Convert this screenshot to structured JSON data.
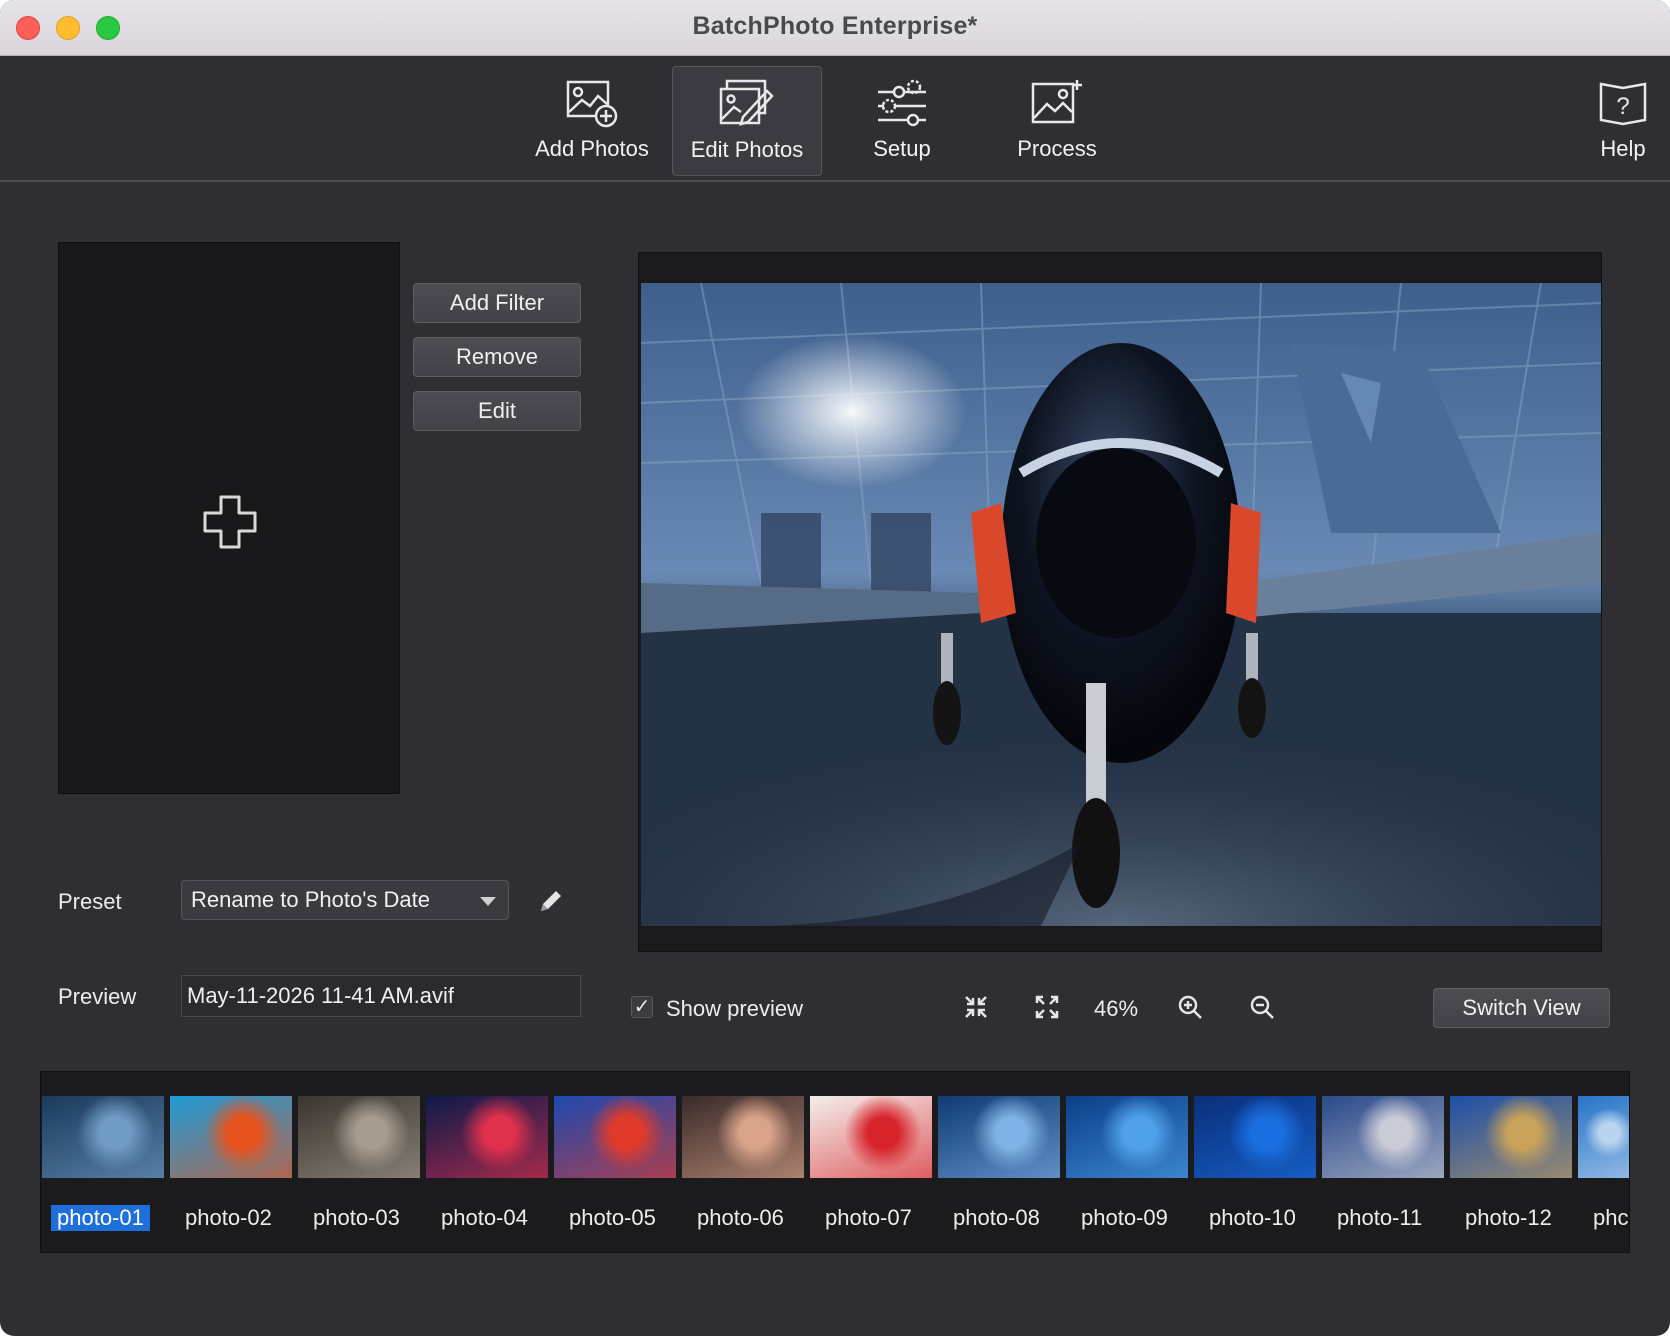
{
  "window": {
    "title": "BatchPhoto Enterprise*"
  },
  "toolbar": {
    "items": [
      {
        "label": "Add Photos",
        "icon": "add-photos-icon"
      },
      {
        "label": "Edit Photos",
        "icon": "edit-photos-icon",
        "active": true
      },
      {
        "label": "Setup",
        "icon": "setup-gears-icon"
      },
      {
        "label": "Process",
        "icon": "process-icon"
      }
    ],
    "help": {
      "label": "Help",
      "icon": "help-book-icon"
    }
  },
  "filters": {
    "add_label": "Add Filter",
    "remove_label": "Remove",
    "edit_label": "Edit"
  },
  "preset": {
    "label": "Preset",
    "value": "Rename to Photo's Date"
  },
  "preview_name": {
    "label": "Preview",
    "value": "May-11-2026 11-41 AM.avif"
  },
  "preview_controls": {
    "show_preview_label": "Show preview",
    "show_preview_checked": true,
    "zoom": "46%",
    "switch_view_label": "Switch View"
  },
  "filmstrip": {
    "items": [
      {
        "label": "photo-01",
        "selected": true,
        "colors": [
          "#1b3a5c",
          "#6f9bc4"
        ]
      },
      {
        "label": "photo-02",
        "colors": [
          "#1f9bd6",
          "#e8521c"
        ]
      },
      {
        "label": "photo-03",
        "colors": [
          "#3a3530",
          "#a69c8f"
        ]
      },
      {
        "label": "photo-04",
        "colors": [
          "#0c1a4a",
          "#e1304c"
        ]
      },
      {
        "label": "photo-05",
        "colors": [
          "#1c49b0",
          "#e23a2a"
        ]
      },
      {
        "label": "photo-06",
        "colors": [
          "#3a2b2a",
          "#d9a38a"
        ]
      },
      {
        "label": "photo-07",
        "colors": [
          "#f3efeb",
          "#d7232a"
        ]
      },
      {
        "label": "photo-08",
        "colors": [
          "#0f3a73",
          "#7fb2e6"
        ]
      },
      {
        "label": "photo-09",
        "colors": [
          "#0a3f8a",
          "#4fa2e9"
        ]
      },
      {
        "label": "photo-10",
        "colors": [
          "#0a2f7a",
          "#1a6fe0"
        ]
      },
      {
        "label": "photo-11",
        "colors": [
          "#2a4a8a",
          "#c9cbd6"
        ]
      },
      {
        "label": "photo-12",
        "colors": [
          "#1d4fa8",
          "#c9a25a"
        ]
      },
      {
        "label": "phc",
        "colors": [
          "#2874c8",
          "#b9d4ef"
        ]
      }
    ]
  }
}
